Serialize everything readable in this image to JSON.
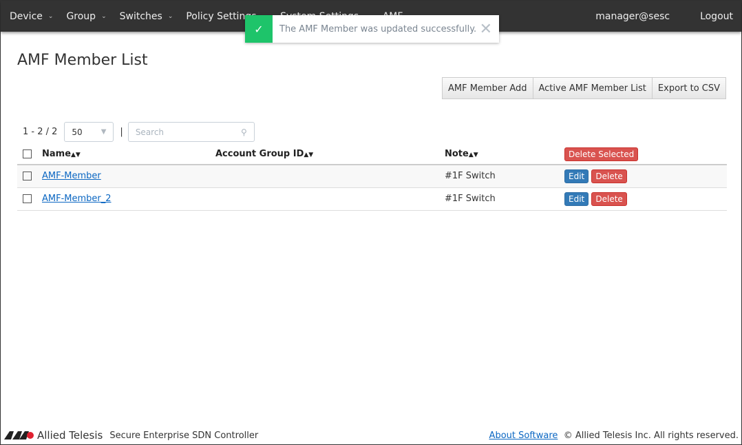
{
  "nav": {
    "items": [
      "Device",
      "Group",
      "Switches",
      "Policy Settings",
      "System Settings",
      "AMF"
    ],
    "user": "manager@sesc",
    "logout": "Logout"
  },
  "toast": {
    "message": "The AMF Member was updated successfully."
  },
  "page": {
    "title": "AMF Member List"
  },
  "toolbar": {
    "add": "AMF Member Add",
    "active": "Active AMF Member List",
    "export": "Export to CSV"
  },
  "list": {
    "range": "1 - 2 / 2",
    "page_size": "50",
    "search_placeholder": "Search"
  },
  "table": {
    "headers": {
      "name": "Name",
      "account": "Account Group ID",
      "note": "Note"
    },
    "delete_selected": "Delete Selected",
    "edit": "Edit",
    "delete": "Delete",
    "rows": [
      {
        "name": "AMF-Member",
        "account": "",
        "note": "#1F Switch"
      },
      {
        "name": "AMF-Member_2",
        "account": "",
        "note": "#1F Switch"
      }
    ]
  },
  "footer": {
    "brand": "Allied Telesis",
    "product": "Secure Enterprise SDN Controller",
    "about": "About Software",
    "copyright": "© Allied Telesis Inc. All rights reserved."
  }
}
